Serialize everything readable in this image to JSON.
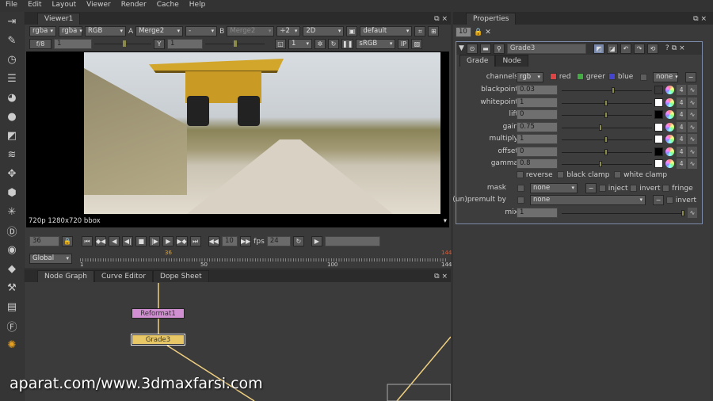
{
  "menu": [
    "File",
    "Edit",
    "Layout",
    "Viewer",
    "Render",
    "Cache",
    "Help"
  ],
  "viewer": {
    "tab": "Viewer1",
    "channels1": "rgba",
    "channels2": "rgba",
    "display_channel": "RGB",
    "a_label": "A",
    "a_input": "Merge2",
    "wipe": "-",
    "b_label": "B",
    "b_input": "Merge2",
    "downscale": "÷2",
    "mode": "2D",
    "lut": "default",
    "fstop": "f/8",
    "gain": "1",
    "gamma_label": "Y",
    "gamma": "1",
    "proxy": "1",
    "colorspace": "sRGB",
    "ip": "IP",
    "info": "720p 1280x720 bbox"
  },
  "timeline": {
    "frame": "36",
    "increment": "10",
    "fps_label": "fps",
    "fps": "24",
    "range": "Global",
    "ticks": [
      "1",
      "50",
      "100",
      "144"
    ],
    "current_marker": "36",
    "end_marker": "144"
  },
  "nodegraph": {
    "tabs": [
      "Node Graph",
      "Curve Editor",
      "Dope Sheet"
    ],
    "nodes": [
      "Reformat1",
      "Grade3"
    ]
  },
  "properties": {
    "title": "Properties",
    "max_panels": "10",
    "node_name": "Grade3",
    "tabs": [
      "Grade",
      "Node"
    ],
    "channels": {
      "label": "channels",
      "value": "rgb",
      "red": "red",
      "green": "green",
      "blue": "blue",
      "extra": "none"
    },
    "params": [
      {
        "label": "blackpoint",
        "value": "0.03",
        "swatch": "#3a3a3a",
        "knob": 0.55
      },
      {
        "label": "whitepoint",
        "value": "1",
        "swatch": "#ffffff",
        "knob": 0.47
      },
      {
        "label": "lift",
        "value": "0",
        "swatch": "#000000",
        "knob": 0.47
      },
      {
        "label": "gain",
        "value": "0.75",
        "swatch": "#ffffff",
        "knob": 0.41
      },
      {
        "label": "multiply",
        "value": "1",
        "swatch": "#ffffff",
        "knob": 0.47
      },
      {
        "label": "offset",
        "value": "0",
        "swatch": "#000000",
        "knob": 0.47
      },
      {
        "label": "gamma",
        "value": "0.8",
        "swatch": "#ffffff",
        "knob": 0.41
      }
    ],
    "four": "4",
    "reverse": "reverse",
    "black_clamp": "black clamp",
    "white_clamp": "white clamp",
    "mask": {
      "label": "mask",
      "value": "none",
      "inject": "inject",
      "invert": "invert",
      "fringe": "fringe"
    },
    "premult": {
      "label": "(un)premult by",
      "value": "none",
      "invert": "invert"
    },
    "mix": {
      "label": "mix",
      "value": "1"
    }
  },
  "watermark": "aparat.com/www.3dmaxfarsi.com"
}
